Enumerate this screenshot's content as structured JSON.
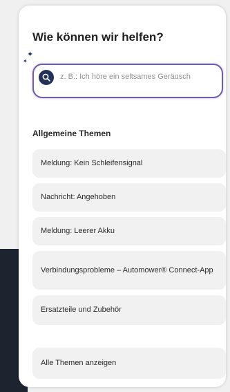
{
  "help": {
    "title": "Wie können wir helfen?",
    "search_placeholder": "z. B.: Ich höre ein seltsames Geräusch"
  },
  "topics": {
    "section_title": "Allgemeine Themen",
    "items": [
      {
        "label": "Meldung: Kein Schleifensignal"
      },
      {
        "label": "Nachricht: Angehoben"
      },
      {
        "label": "Meldung: Leerer Akku"
      },
      {
        "label": "Verbindungsprobleme – Automower® Connect-App"
      },
      {
        "label": "Ersatzteile und Zubehör"
      }
    ],
    "show_all_label": "Alle Themen anzeigen"
  },
  "colors": {
    "accent": "#233058",
    "search_border": "#6b5fa8",
    "item_background": "#f1f1f1"
  },
  "icons": {
    "search": "search-icon",
    "sparkle": "sparkle-icon"
  }
}
